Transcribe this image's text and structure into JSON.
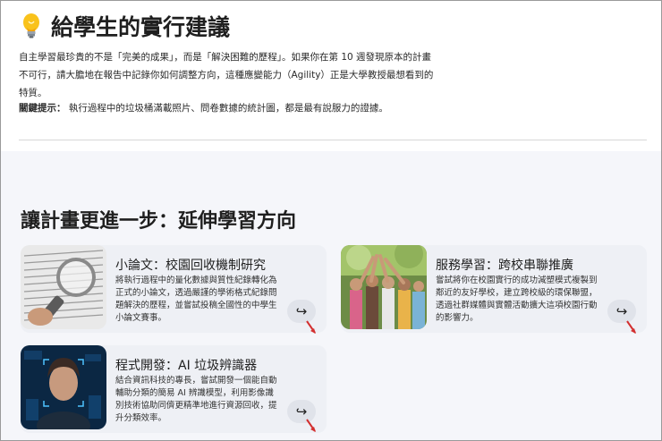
{
  "header": {
    "title": "給學生的實行建議"
  },
  "intro": {
    "paragraph": "自主學習最珍貴的不是「完美的成果」，而是「解決困難的歷程」。如果你在第 10 週發現原本的計畫不可行，請大膽地在報告中記錄你如何調整方向，這種應變能力（Agility）正是大學教授最想看到的特質。",
    "tip_label": "關鍵提示：",
    "tip_text": " 執行過程中的垃圾桶滿載照片、問卷數據的統計圖，都是最有說服力的證據。"
  },
  "section": {
    "title": "讓計畫更進一步：延伸學習方向"
  },
  "cards": [
    {
      "title": "小論文：校園回收機制研究",
      "desc": "將執行過程中的量化數據與質性紀錄轉化為正式的小論文，透過嚴謹的學術格式紀錄問題解決的歷程，並嘗試投稿全國性的中學生小論文賽事。",
      "arrow": "↪"
    },
    {
      "title": "服務學習：跨校串聯推廣",
      "desc": "嘗試將你在校園實行的成功減塑模式複製到鄰近的友好學校，建立跨校級的環保聯盟，透過社群媒體與實體活動擴大這項校園行動的影響力。",
      "arrow": "↪"
    },
    {
      "title": "程式開發：AI 垃圾辨識器",
      "desc": "結合資訊科技的專長，嘗試開發一個能自動輔助分類的簡易 AI 辨識模型，利用影像識別技術協助同儕更精準地進行資源回收，提升分類效率。",
      "arrow": "↪"
    }
  ],
  "colors": {
    "pointer": "#d32f2f",
    "card_bg": "#eef0f5",
    "section_bg": "#f5f6fa"
  }
}
